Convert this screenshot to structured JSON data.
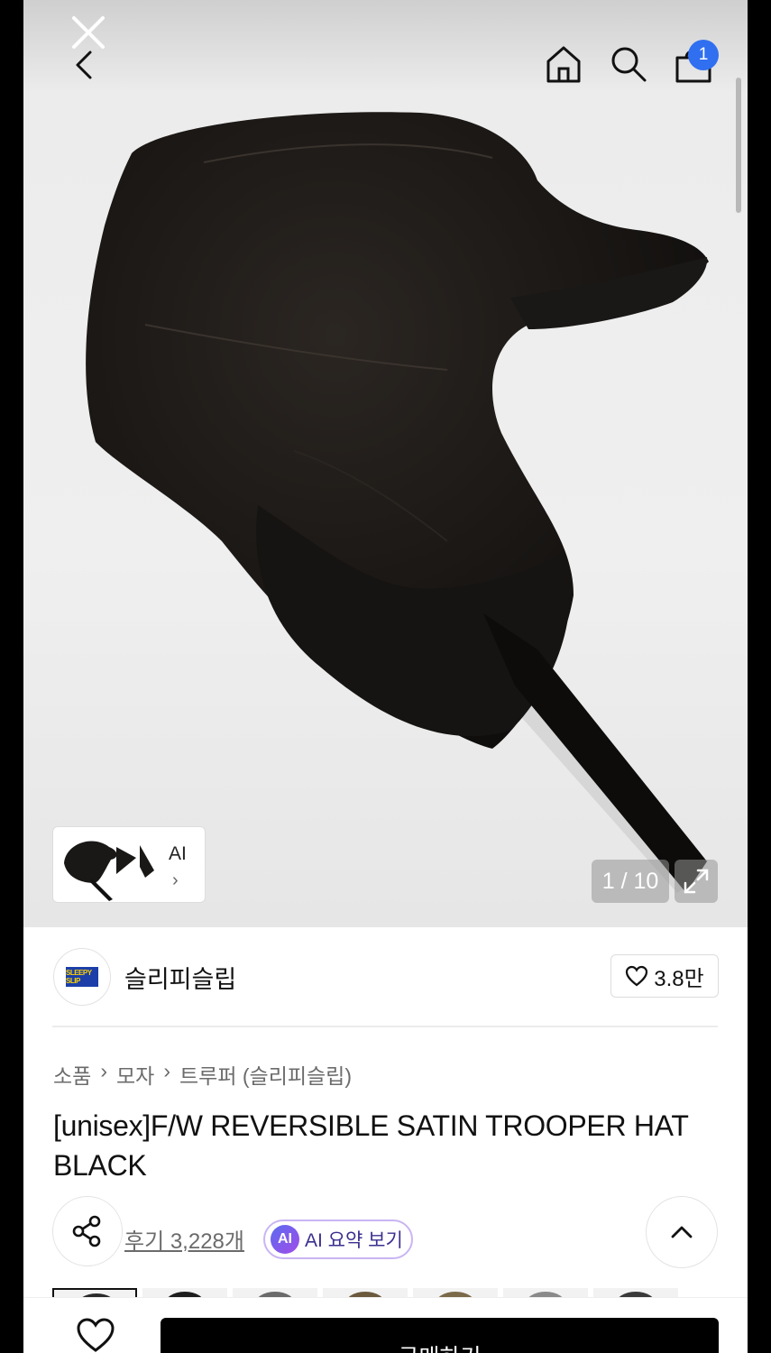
{
  "header": {
    "cart_count": "1",
    "icons": [
      "close-icon",
      "back-arrow-icon",
      "home-icon",
      "search-icon",
      "shopping-bag-icon"
    ]
  },
  "gallery": {
    "ai_label": "AI",
    "ai_chevron": "›",
    "counter": "1 / 10"
  },
  "shop": {
    "name": "슬리피슬립",
    "logo_text": "SLEEPY SLIP",
    "likes": "3.8만"
  },
  "breadcrumb": [
    "소품",
    "모자",
    "트루퍼 (슬리피슬립)"
  ],
  "breadcrumb_separator": "›",
  "product": {
    "title": "[unisex]F/W REVERSIBLE SATIN TROOPER HAT BLACK"
  },
  "actions": {
    "reviews": "후기 3,228개",
    "ai_badge": "AI",
    "ai_summary": "AI 요약 보기"
  },
  "swatch_colors": [
    "#2b2b2b",
    "#1e1e1e",
    "#6a6a6a",
    "#6b5a3e",
    "#7a6a4a",
    "#8a8a8a",
    "#3a3a3a"
  ],
  "bottom": {
    "buy_label": "구매하기"
  },
  "colors": {
    "accent_blue": "#2f6ff0",
    "buy_button": "#000000",
    "ai_border": "#c9b5f3"
  }
}
